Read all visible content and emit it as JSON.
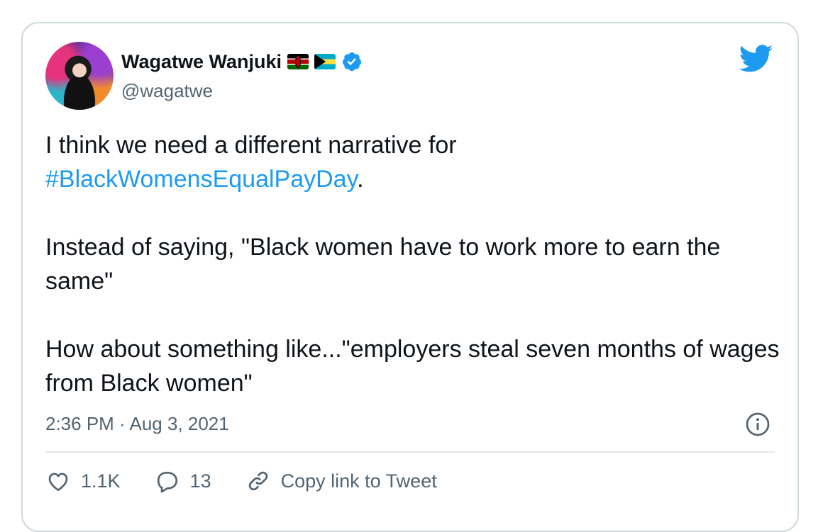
{
  "tweet": {
    "author_name": "Wagatwe Wanjuki",
    "handle": "@wagatwe",
    "text_line1": "I think we need a different narrative for",
    "hashtag": "#BlackWomensEqualPayDay",
    "hashtag_suffix": ".",
    "paragraph2": "Instead of saying, \"Black women have to work more to earn the same\"",
    "paragraph3": "How about something like...\"employers steal seven months of wages from Black women\"",
    "timestamp": "2:36 PM · Aug 3, 2021"
  },
  "actions": {
    "likes": "1.1K",
    "replies": "13",
    "copy_link": "Copy link to Tweet"
  },
  "colors": {
    "accent": "#1d9bf0",
    "secondary_text": "#536471",
    "border": "#cfd9de"
  },
  "icons": [
    "twitter-bird-icon",
    "verified-badge-icon",
    "kenya-flag-icon",
    "bahamas-flag-icon",
    "info-icon",
    "heart-icon",
    "reply-icon",
    "link-icon"
  ]
}
